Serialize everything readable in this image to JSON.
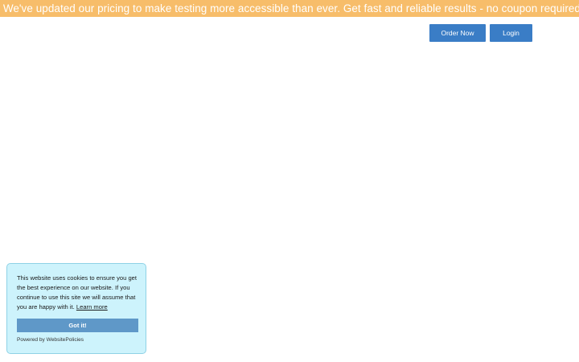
{
  "banner": {
    "text": "ummer pricing is here! We've updated our pricing to make testing more accessible than ever. Get fast and reliable results - no coupon required",
    "background": "#f7bd6a"
  },
  "header": {
    "order_button": "Order Now",
    "login_button": "Login",
    "button_color": "#3a7dc6"
  },
  "cookie_popup": {
    "message": "This website uses cookies to ensure you get the best experience on our website. If you continue to use this site we will assume that you are happy with it.",
    "learn_more": "Learn more",
    "accept_button": "Got it!",
    "powered_by": "Powered by WebsitePolicies",
    "background": "#cdf3fc"
  }
}
